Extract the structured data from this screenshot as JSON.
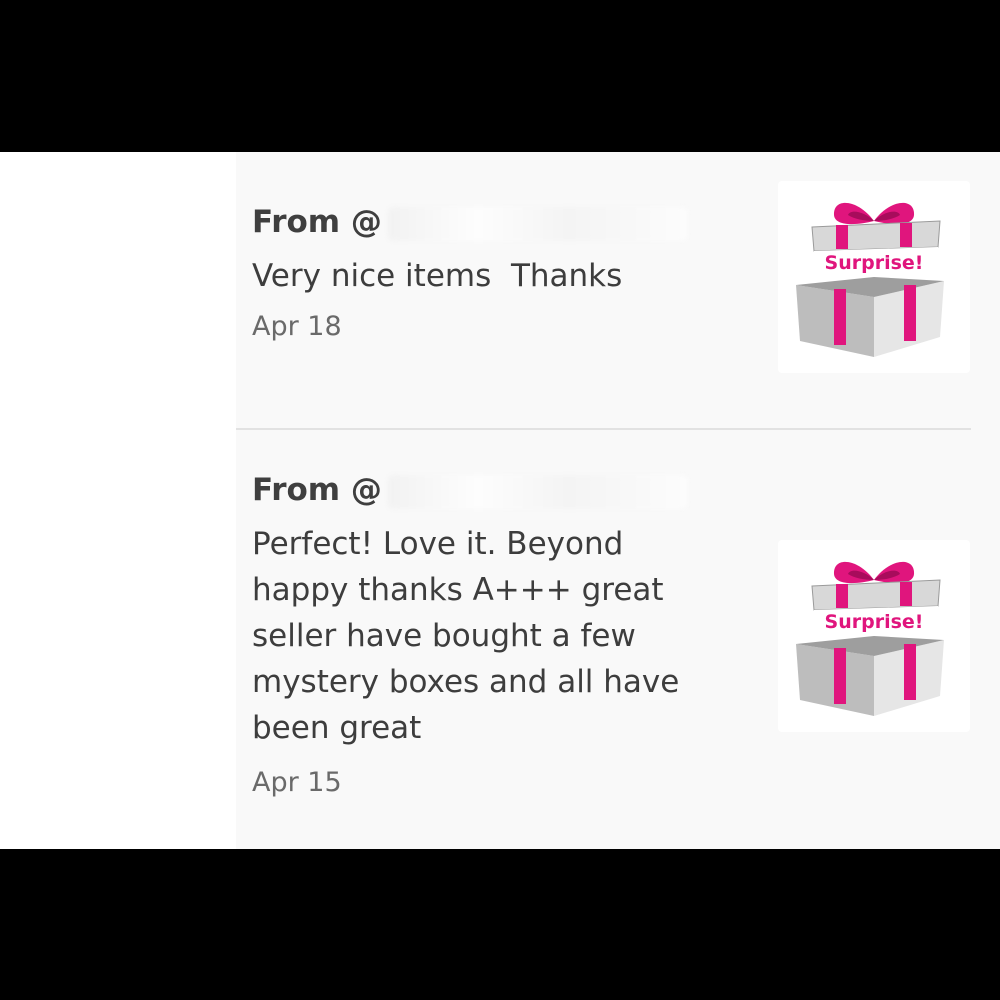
{
  "reviews": [
    {
      "from_prefix": "From @",
      "text": "Very nice items  Thanks",
      "date": "Apr 18",
      "thumbnail_label": "Surprise!"
    },
    {
      "from_prefix": "From @",
      "text": "Perfect! Love it. Beyond\nhappy thanks A+++ great\nseller have bought a few\nmystery boxes and all have\nbeen great",
      "date": "Apr 15",
      "thumbnail_label": "Surprise!"
    }
  ],
  "colors": {
    "ribbon": "#e0157d",
    "box": "#c9c9c9",
    "text": "#3d3d3d",
    "date": "#6a6a6a"
  },
  "icons": [
    "gift-box-icon"
  ]
}
